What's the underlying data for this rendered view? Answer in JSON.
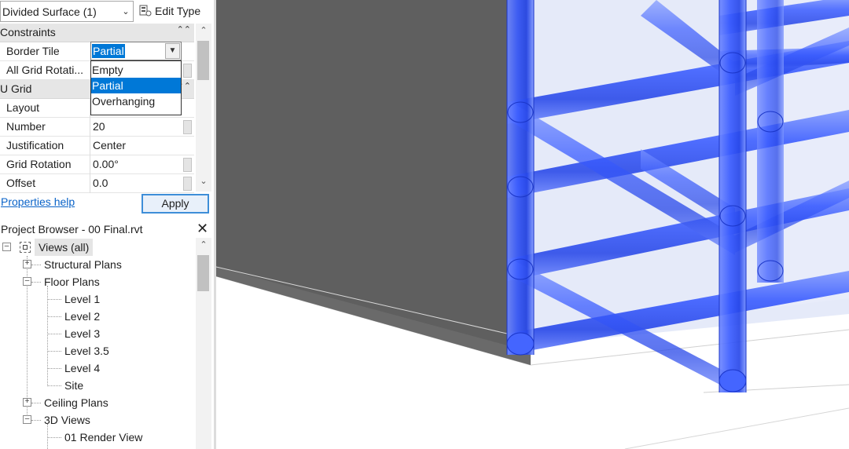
{
  "properties": {
    "type_selector": "Divided Surface (1)",
    "edit_type_label": "Edit Type",
    "sections": {
      "constraints": "Constraints",
      "u_grid": "U Grid"
    },
    "rows": [
      {
        "label": "Border Tile",
        "value": "Partial"
      },
      {
        "label": "All Grid Rotati...",
        "value": ""
      },
      {
        "label": "Layout",
        "value": ""
      },
      {
        "label": "Number",
        "value": "20"
      },
      {
        "label": "Justification",
        "value": "Center"
      },
      {
        "label": "Grid Rotation",
        "value": "0.00°"
      },
      {
        "label": "Offset",
        "value": "0.0"
      }
    ],
    "border_tile_dropdown": {
      "selected": "Partial",
      "options": [
        "Empty",
        "Partial",
        "Overhanging"
      ]
    },
    "help_link": "Properties help",
    "apply_label": "Apply"
  },
  "project_browser": {
    "title": "Project Browser - 00 Final.rvt",
    "root": "Views (all)",
    "structural_plans": "Structural Plans",
    "floor_plans": "Floor Plans",
    "floor_plan_items": [
      "Level 1",
      "Level 2",
      "Level 3",
      "Level 3.5",
      "Level 4",
      "Site"
    ],
    "ceiling_plans": "Ceiling Plans",
    "three_d_views": "3D Views",
    "three_d_items": [
      "01 Render View"
    ]
  },
  "colors": {
    "selection_blue": "#0078d7",
    "structure_blue": "#2f5bff",
    "mass_gray": "#5f5f5f"
  }
}
